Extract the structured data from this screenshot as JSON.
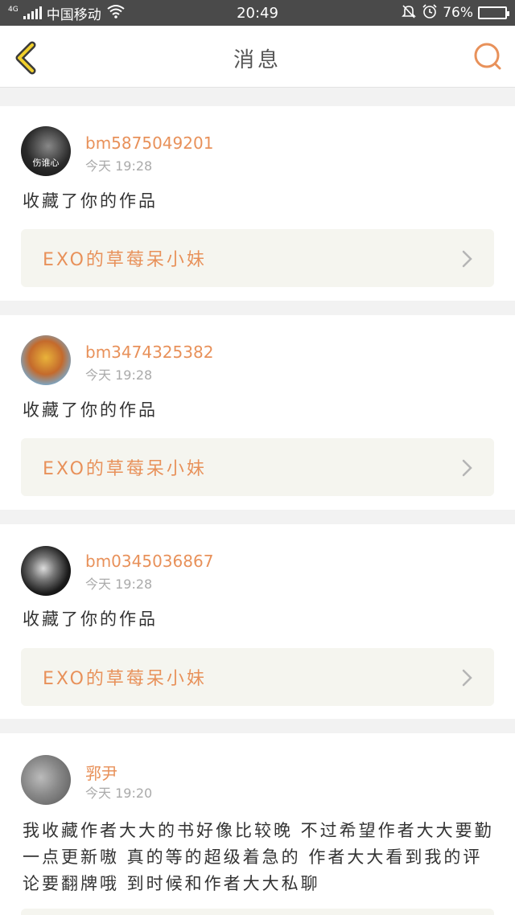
{
  "status_bar": {
    "network": "4G",
    "carrier": "中国移动",
    "time": "20:49",
    "battery": "76%",
    "battery_level": 0.76,
    "icons": [
      "signal-icon",
      "wifi-icon",
      "silent-icon",
      "alarm-icon",
      "battery-icon"
    ]
  },
  "nav": {
    "title": "消息",
    "back_icon": "chevron-left-icon",
    "search_icon": "search-icon",
    "accent": "#e8915a"
  },
  "messages": [
    {
      "user": "bm5875049201",
      "time": "今天 19:28",
      "text": "收藏了你的作品",
      "work": "EXO的草莓呆小妹",
      "avatar_text": "伤谁心"
    },
    {
      "user": "bm3474325382",
      "time": "今天 19:28",
      "text": "收藏了你的作品",
      "work": "EXO的草莓呆小妹"
    },
    {
      "user": "bm0345036867",
      "time": "今天 19:28",
      "text": "收藏了你的作品",
      "work": "EXO的草莓呆小妹"
    },
    {
      "user": "郛尹",
      "time": "今天 19:20",
      "text": "我收藏作者大大的书好像比较晚 不过希望作者大大要勤一点更新嗷 真的等的超级着急的 作者大大看到我的评论要翻牌哦 到时候和作者大大私聊"
    }
  ]
}
